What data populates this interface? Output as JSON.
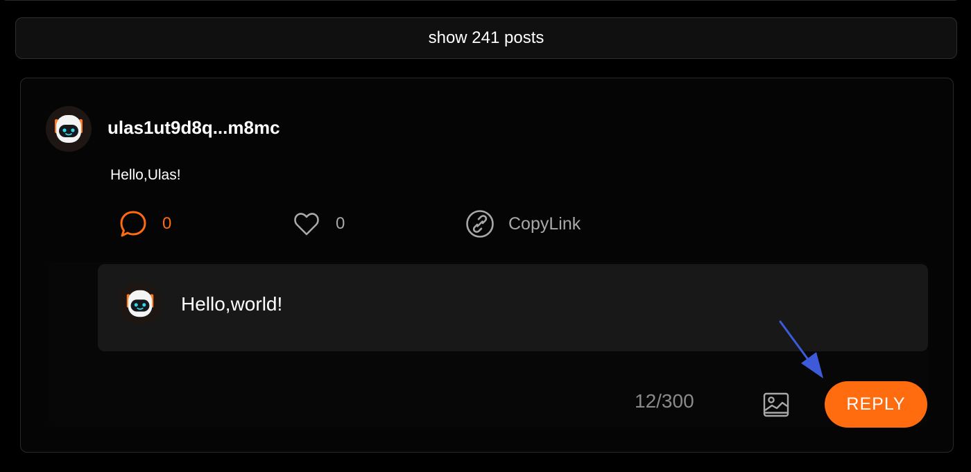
{
  "feed": {
    "show_posts_label": "show 241 posts"
  },
  "post": {
    "username": "ulas1ut9d8q...m8mc",
    "text": "Hello,Ulas!",
    "comment_count": "0",
    "like_count": "0",
    "copy_link_label": "CopyLink"
  },
  "reply": {
    "input_value": "Hello,world!",
    "char_count": "12/300",
    "submit_label": "REPLY"
  },
  "colors": {
    "accent": "#ff6b0f",
    "annotation_arrow": "#3d5bd9"
  },
  "icons": [
    "robot-avatar-icon",
    "comment-icon",
    "heart-icon",
    "link-icon",
    "image-icon",
    "annotation-arrow"
  ]
}
